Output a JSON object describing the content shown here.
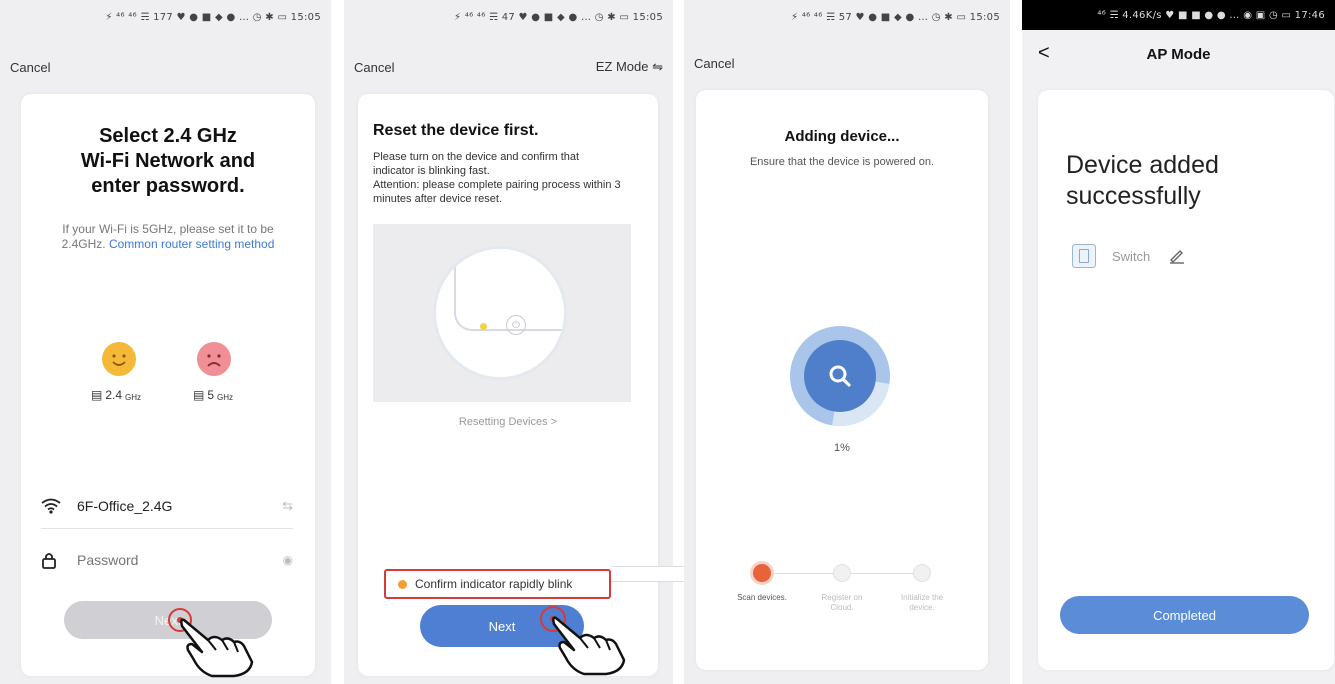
{
  "screen1": {
    "status": "⚡ ⁴⁶ ⁴⁶ ☴ 177 ♥ ● ■ ◆ ● …  ◷ ✱ ▭ 15:05",
    "cancel_label": "Cancel",
    "title_line1": "Select 2.4 GHz",
    "title_line2": "Wi-Fi Network and",
    "title_line3": "enter password.",
    "hint_text": "If your Wi-Fi is 5GHz, please set it to be 2.4GHz.",
    "hint_link": "Common router setting method",
    "band_24_label": "2.4",
    "band_24_unit": "GHz",
    "band_5_label": "5",
    "band_5_unit": "GHz",
    "wifi_name": "6F-Office_2.4G",
    "password_placeholder": "Password",
    "next_label": "Next"
  },
  "screen2": {
    "status": "⚡ ⁴⁶ ⁴⁶ ☴ 47 ♥ ● ■ ◆ ● …  ◷ ✱ ▭ 15:05",
    "cancel_label": "Cancel",
    "mode_label": "EZ Mode ⇋",
    "title": "Reset the device first.",
    "desc1": "Please turn on the device and confirm that indicator is blinking fast.",
    "desc2": "Attention: please complete pairing process within 3 minutes after device reset.",
    "resetting_link": "Resetting Devices >",
    "confirm_label": "Confirm indicator rapidly blink",
    "next_label": "Next"
  },
  "screen3": {
    "status": "⚡ ⁴⁶ ⁴⁶ ☴ 57 ♥ ● ■ ◆ ● …  ◷ ✱ ▭ 15:05",
    "cancel_label": "Cancel",
    "title": "Adding device...",
    "subtitle": "Ensure that the device is powered on.",
    "progress_text": "1%",
    "progress_value": 0.01,
    "steps": [
      {
        "label": "Scan devices."
      },
      {
        "label": "Register on Cloud."
      },
      {
        "label": "Initialize the device."
      }
    ]
  },
  "screen4": {
    "status": "⁴⁶ ☴ 4.46K/s ♥ ■ ■ ● ● …  ◉ ▣ ◷ ▭ 17:46",
    "back_label": "<",
    "title": "AP Mode",
    "success_line1": "Device added",
    "success_line2": "successfully",
    "device_name": "Switch",
    "completed_label": "Completed"
  },
  "colors": {
    "accent": "#4e7fd3",
    "orange": "#e8623a",
    "smile": "#f5b93a",
    "sad": "#f08f95",
    "highlight": "#d63a3a"
  }
}
